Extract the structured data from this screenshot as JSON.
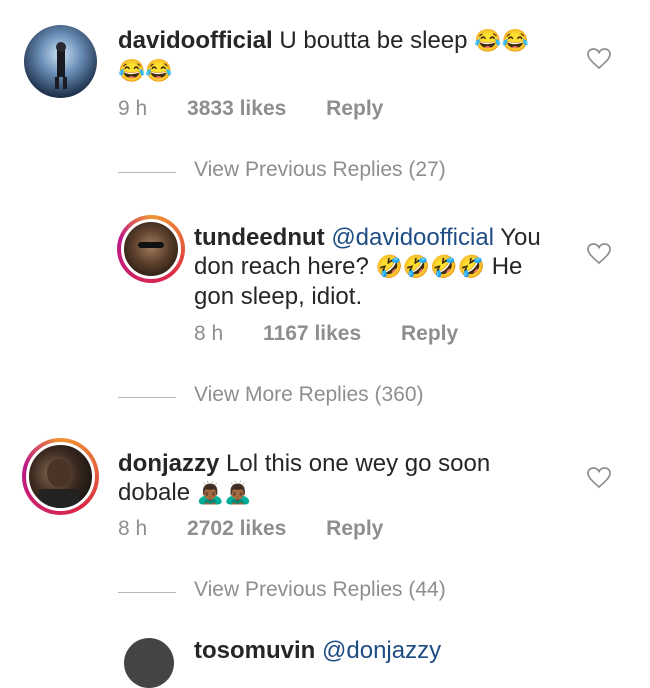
{
  "comments": [
    {
      "username": "davidoofficial",
      "text": "U boutta be sleep",
      "emoji_line1": "😂😂",
      "emoji_line2": "😂😂",
      "time": "9 h",
      "likes": "3833 likes",
      "reply": "Reply"
    },
    {
      "username": "tundeednut",
      "mention": "@davidoofficial",
      "text1": "You",
      "text2": "don reach here?",
      "emojis": "🤣🤣🤣🤣",
      "text3": "He",
      "text4": "gon sleep, idiot.",
      "time": "8 h",
      "likes": "1167 likes",
      "reply": "Reply"
    },
    {
      "username": "donjazzy",
      "text1": "Lol this one wey go soon",
      "text2": "dobale",
      "emojis": "🙇🏾‍♂️🙇🏾‍♂️",
      "time": "8 h",
      "likes": "2702 likes",
      "reply": "Reply"
    }
  ],
  "view_previous_1": "View Previous Replies (27)",
  "view_more": "View More Replies (360)",
  "view_previous_2": "View Previous Replies (44)",
  "partial_next": {
    "username": "tosomuvin",
    "mention": "@donjazzy"
  },
  "colors": {
    "text": "#262626",
    "secondary": "#8e8e8e",
    "mention": "#1e4d86"
  },
  "icons": [
    "heart-outline-icon"
  ]
}
